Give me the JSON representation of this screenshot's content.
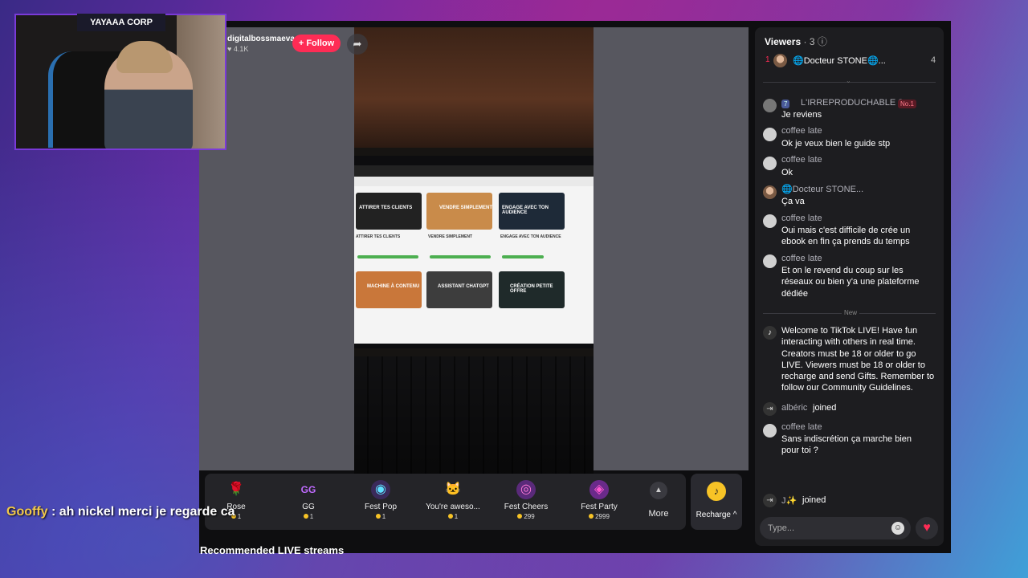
{
  "webcam": {
    "title": "YAYAAA CORP"
  },
  "overlay_chat": {
    "user": "Gooffy",
    "text": ": ah nickel merci je regarde ca"
  },
  "host": {
    "name": "digitalbossmaeva",
    "likes": "♥ 4.1K",
    "follow_label": "+ Follow"
  },
  "video_screen": {
    "cards": [
      "ATTIRER TES CLIENTS",
      "VENDRE SIMPLEMENT",
      "ENGAGE AVEC TON AUDIENCE",
      "MACHINE À CONTENU",
      "ASSISTANT CHATGPT",
      "CRÉATION PETITE OFFRE"
    ],
    "captions": [
      "ATTIRER TES CLIENTS",
      "VENDRE SIMPLEMENT",
      "ENGAGE AVEC TON AUDIENCE"
    ]
  },
  "gifts": [
    {
      "name": "Rose",
      "price": "1",
      "icon": "rose-icon",
      "glyph": "🌹"
    },
    {
      "name": "GG",
      "price": "1",
      "icon": "gg-icon",
      "glyph": "GG"
    },
    {
      "name": "Fest Pop",
      "price": "1",
      "icon": "fest-pop-icon",
      "glyph": "◉"
    },
    {
      "name": "You're aweso...",
      "price": "1",
      "icon": "cat-icon",
      "glyph": "🐱"
    },
    {
      "name": "Fest Cheers",
      "price": "299",
      "icon": "fest-cheers-icon",
      "glyph": "◎"
    },
    {
      "name": "Fest Party",
      "price": "2999",
      "icon": "fest-party-icon",
      "glyph": "◈"
    }
  ],
  "more_label": "More",
  "recharge_label": "Recharge ^",
  "recommended_title": "Recommended LIVE streams",
  "viewers": {
    "label": "Viewers",
    "count": "· 3",
    "top": {
      "rank": "1",
      "name": "🌐Docteur STONE🌐...",
      "score": "4"
    }
  },
  "chat": [
    {
      "user": "L'IRREPRODUCHABLE 2...",
      "text": "Je reviens",
      "badge_level": "7",
      "badge_rank": "No.1"
    },
    {
      "user": "coffee late",
      "text": "Ok je veux bien le guide stp"
    },
    {
      "user": "coffee late",
      "text": "Ok"
    },
    {
      "user": "🌐Docteur STONE...",
      "text": "Ça va"
    },
    {
      "user": "coffee late",
      "text": "Oui mais c'est difficile de crée un ebook en fin ça prends du temps"
    },
    {
      "user": "coffee late",
      "text": "Et on le revend du coup sur les réseaux ou bien y'a une plateforme dédiée"
    }
  ],
  "new_label": "New",
  "system_message": "Welcome to TikTok LIVE! Have fun interacting with others in real time. Creators must be 18 or older to go LIVE. Viewers must be 18 or older to recharge and send Gifts. Remember to follow our Community Guidelines.",
  "joined1": {
    "user": "albéric",
    "text": "joined"
  },
  "chat_last": {
    "user": "coffee late",
    "text": "Sans indiscrétion ça marche bien pour toi ?"
  },
  "joined2": {
    "user": "J✨",
    "text": "joined"
  },
  "input": {
    "placeholder": "Type..."
  },
  "colors": {
    "accent": "#fe2c55",
    "coin": "#f7c326",
    "panel": "#1d1d20"
  }
}
